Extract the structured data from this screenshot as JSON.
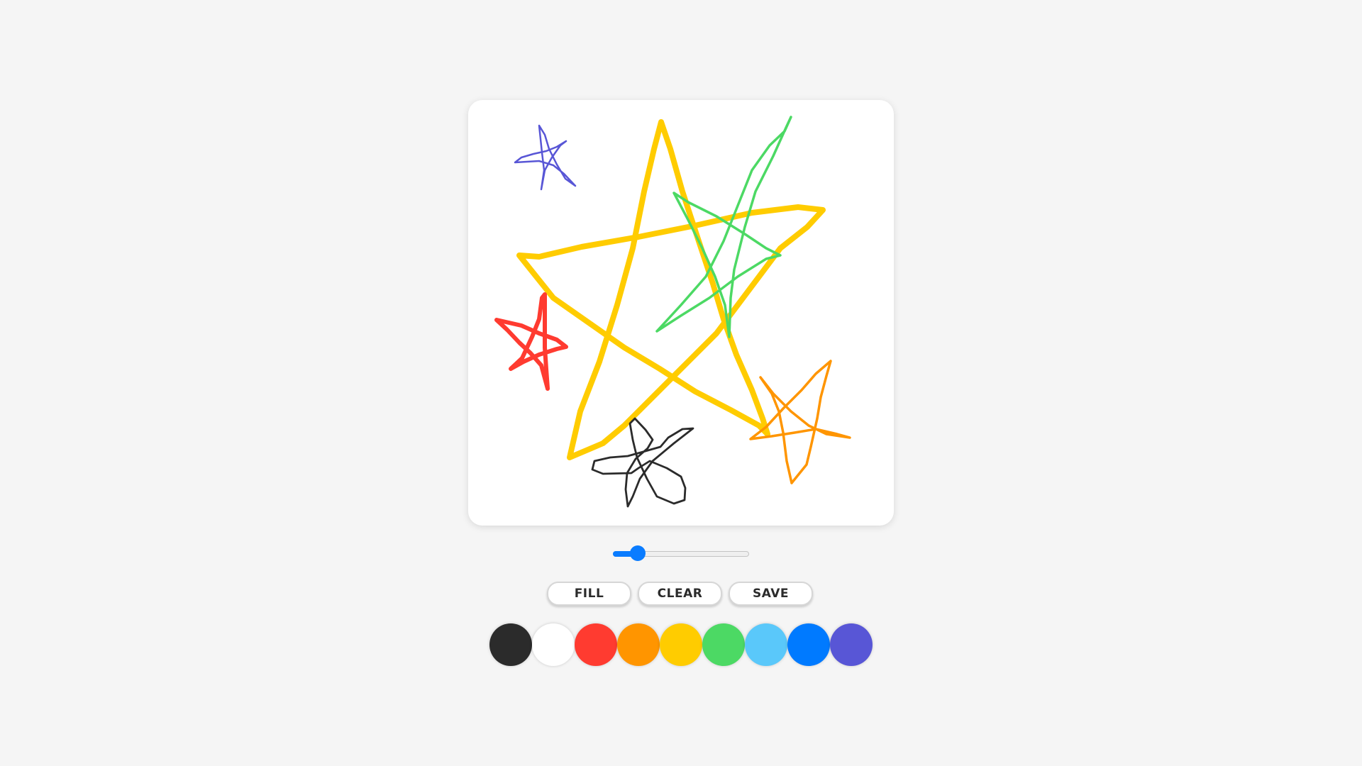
{
  "app": {
    "canvas_background": "#ffffff",
    "page_background": "#f5f5f5"
  },
  "brush_size": {
    "min": 1,
    "max": 50,
    "value": 8,
    "accent_color": "#0a7cff"
  },
  "buttons": {
    "fill_label": "FILL",
    "clear_label": "CLEAR",
    "save_label": "SAVE"
  },
  "palette": [
    {
      "name": "black",
      "color": "#2b2b2b"
    },
    {
      "name": "white",
      "color": "#ffffff"
    },
    {
      "name": "red",
      "color": "#ff3b30"
    },
    {
      "name": "orange",
      "color": "#ff9500"
    },
    {
      "name": "yellow",
      "color": "#ffcc00"
    },
    {
      "name": "green",
      "color": "#4cd964"
    },
    {
      "name": "light-blue",
      "color": "#5ac8fa"
    },
    {
      "name": "blue",
      "color": "#007aff"
    },
    {
      "name": "purple",
      "color": "#5856d6"
    }
  ],
  "strokes": [
    {
      "name": "yellow-star",
      "color": "#ffcc00"
    },
    {
      "name": "green-star",
      "color": "#4cd964"
    },
    {
      "name": "purple-star",
      "color": "#5856d6"
    },
    {
      "name": "red-star",
      "color": "#ff3b30"
    },
    {
      "name": "orange-star",
      "color": "#ff9500"
    },
    {
      "name": "black-flower",
      "color": "#2b2b2b"
    }
  ]
}
